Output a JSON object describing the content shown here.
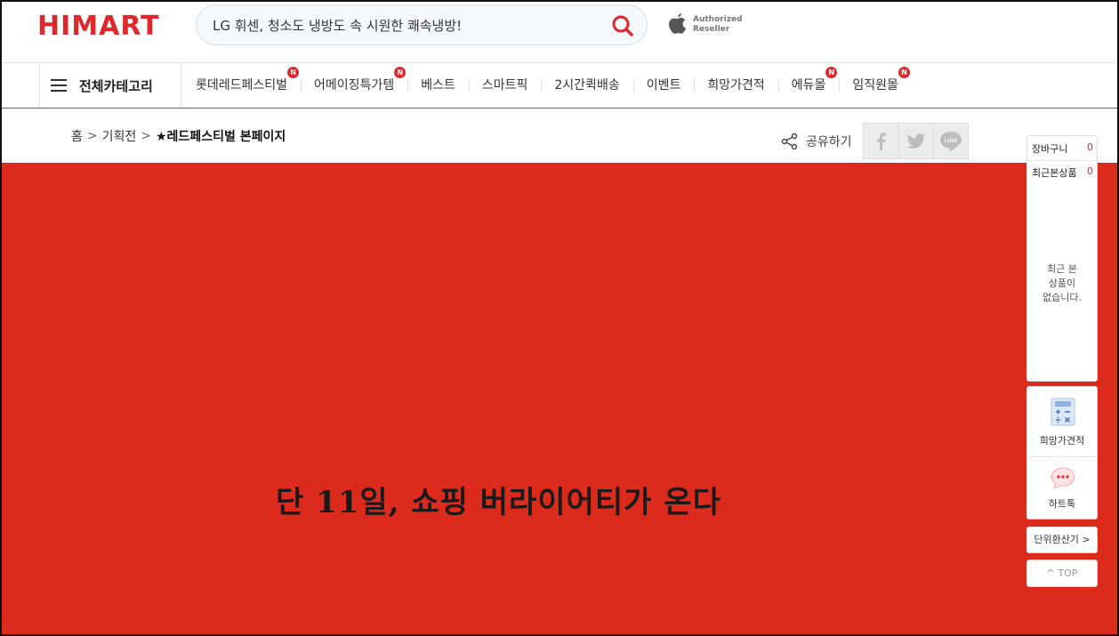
{
  "header": {
    "logo": "HIMART",
    "search_value": "LG 휘센, 청소도 냉방도 속 시원한 쾌속냉방!",
    "apple_badge_line1": "Authorized",
    "apple_badge_line2": "Reseller"
  },
  "nav": {
    "category_label": "전체카테고리",
    "items": [
      {
        "label": "롯데레드페스티벌",
        "new": "N"
      },
      {
        "label": "어메이징특가템",
        "new": "N"
      },
      {
        "label": "베스트"
      },
      {
        "label": "스마트픽"
      },
      {
        "label": "2시간퀵배송"
      },
      {
        "label": "이벤트"
      },
      {
        "label": "희망가견적"
      },
      {
        "label": "에듀몰",
        "new": "N"
      },
      {
        "label": "임직원몰",
        "new": "N"
      }
    ]
  },
  "breadcrumb": {
    "home": "홈",
    "level1": "기획전",
    "current": "★레드페스티벌 본페이지"
  },
  "share": {
    "label": "공유하기",
    "sns_line": "LINE"
  },
  "hero": {
    "headline": "단 11일, 쇼핑 버라이어티가 온다",
    "bg_color": "#dc2b1d"
  },
  "side_panel": {
    "cart_label": "장바구니",
    "cart_count": "0",
    "recent_label": "최근본상품",
    "recent_count": "0",
    "recent_empty_line1": "최근 본",
    "recent_empty_line2": "상품이",
    "recent_empty_line3": "없습니다.",
    "quote_label": "희망가견적",
    "chat_label": "하트톡",
    "unit_label": "단위환산기",
    "top_label": "TOP"
  },
  "colors": {
    "brand": "#e0282c"
  }
}
